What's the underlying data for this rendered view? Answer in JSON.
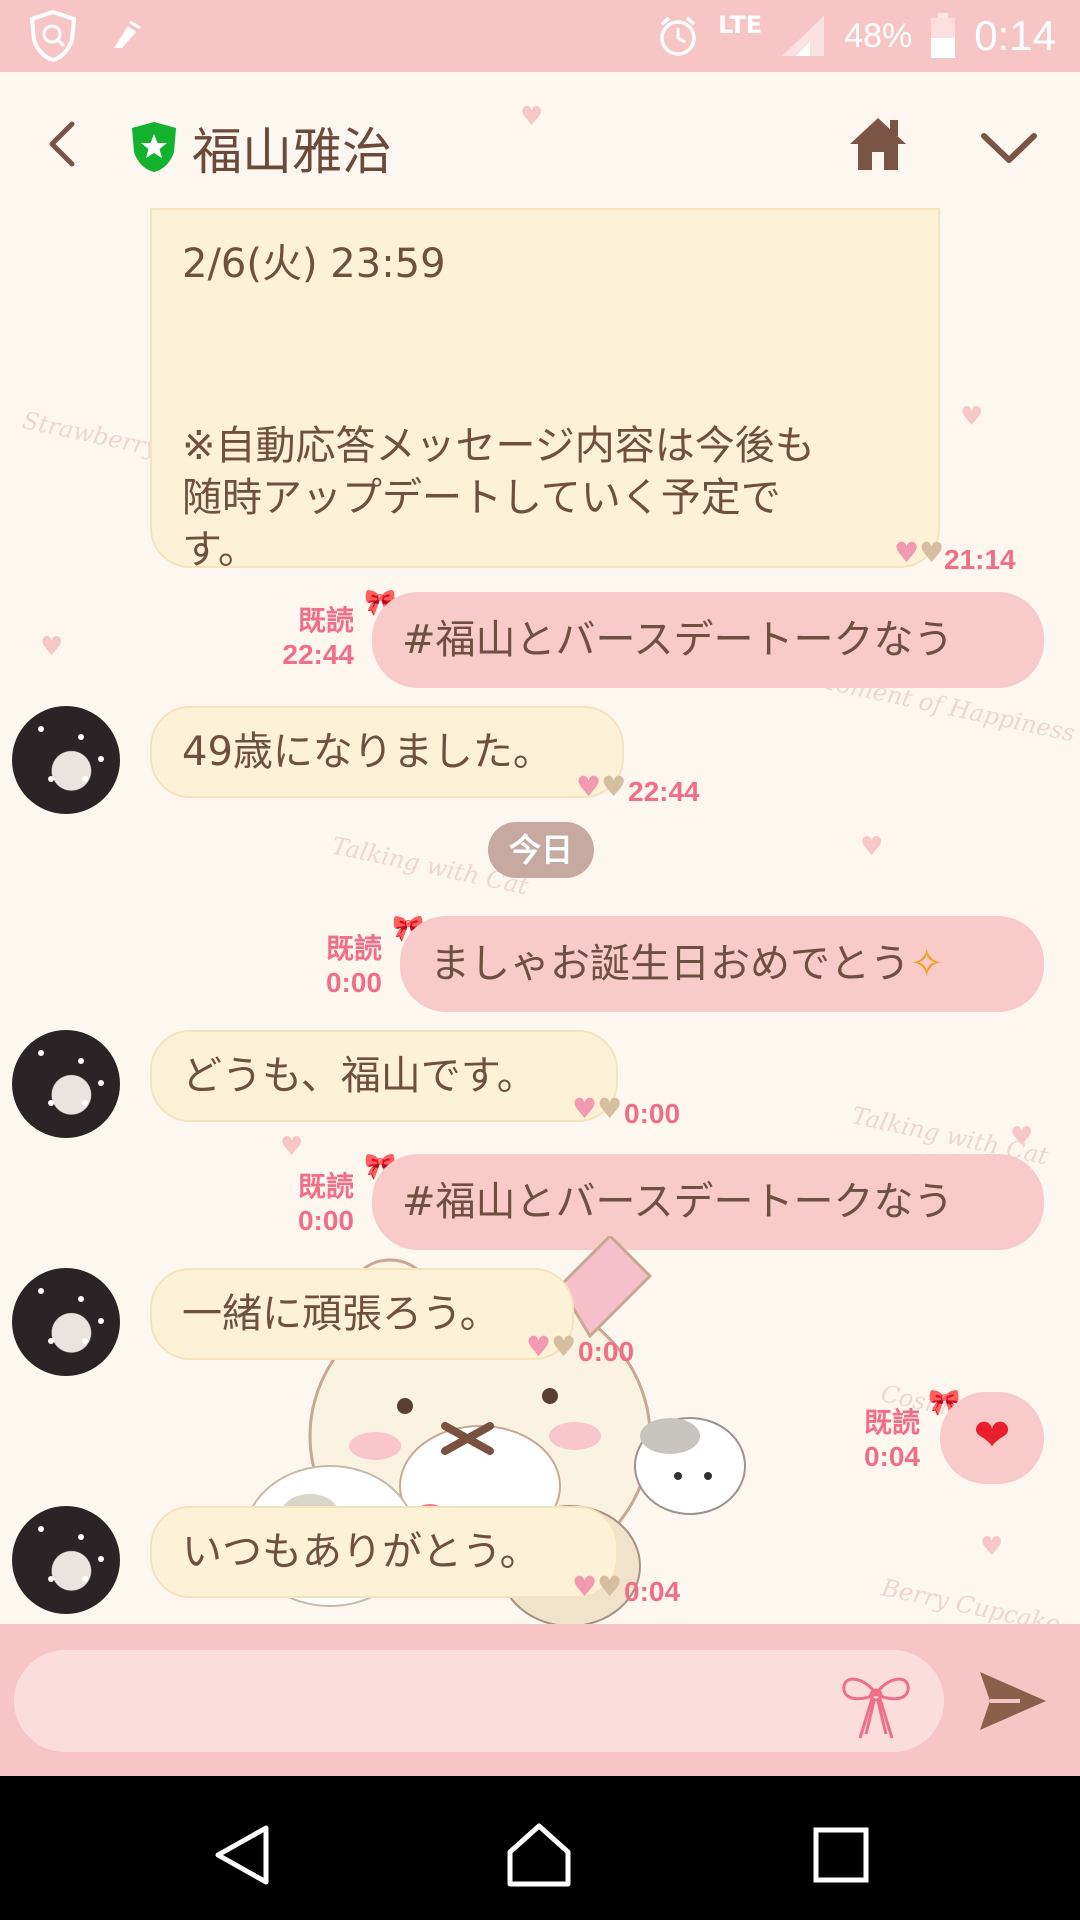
{
  "status_bar": {
    "battery": "48%",
    "time": "0:14",
    "network": "LTE"
  },
  "header": {
    "title": "福山雅治"
  },
  "messages": {
    "m1_partial": "2/6(火) 23:59",
    "m1_text": "※自動応答メッセージ内容は今後も\n随時アップデートしていく予定で\nす。\n※個別に返信することはできません\nのでご了承ください。",
    "m1_time": "21:14",
    "m2_read": "既読",
    "m2_time": "22:44",
    "m2_text": "#福山とバースデートークなう",
    "m3_text": "49歳になりました。",
    "m3_time": "22:44",
    "date_label": "今日",
    "m4_read": "既読",
    "m4_time": "0:00",
    "m4_text": "ましゃお誕生日おめでとう",
    "m5_text": "どうも、福山です。",
    "m5_time": "0:00",
    "m6_read": "既読",
    "m6_time": "0:00",
    "m6_text": "#福山とバースデートークなう",
    "m7_text": "一緒に頑張ろう。",
    "m7_time": "0:00",
    "m8_read": "既読",
    "m8_time": "0:04",
    "m8_text": "❤",
    "m9_text": "いつもありがとう。",
    "m9_time": "0:04"
  },
  "input": {
    "placeholder": ""
  },
  "colors": {
    "status_bar": "#f7c5c3",
    "incoming_bubble": "#fdf2d8",
    "outgoing_bubble": "#f8cac8",
    "meta_pink": "#f06f87",
    "date_pill": "#c6aaa0"
  },
  "icons": [
    "shield-icon",
    "back-arrow-icon",
    "verified-shield-icon",
    "home-icon",
    "chevron-down-icon",
    "ribbon-icon",
    "send-icon",
    "nav-back-icon",
    "nav-home-icon",
    "nav-recents-icon"
  ]
}
